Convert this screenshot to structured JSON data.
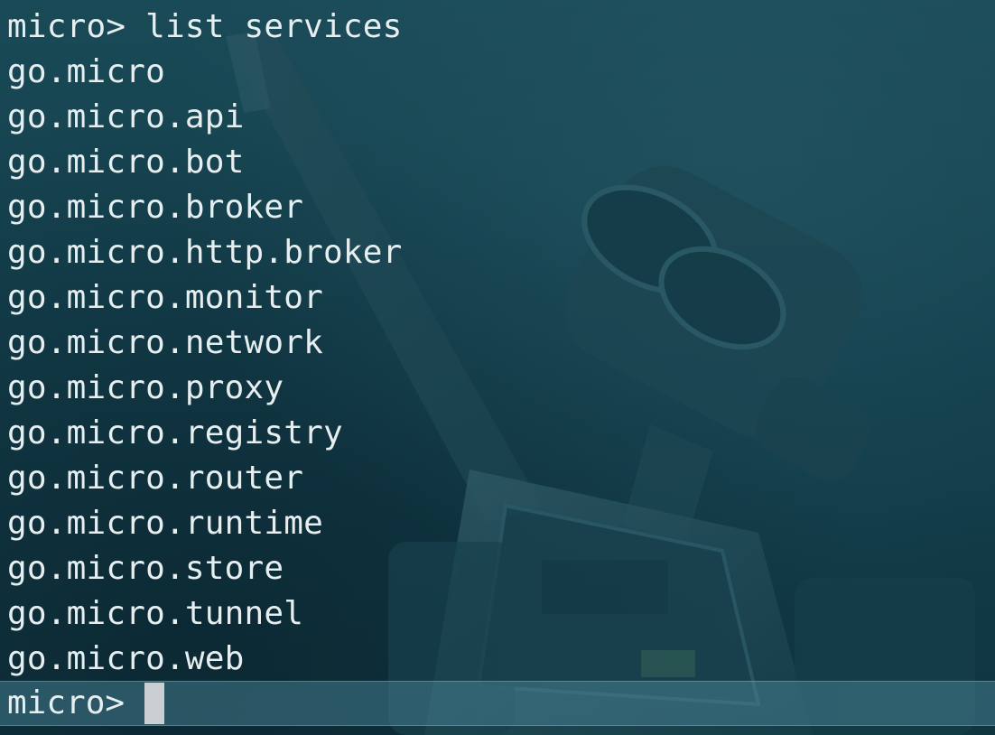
{
  "terminal": {
    "command_line": "micro> list services",
    "output": [
      "go.micro",
      "go.micro.api",
      "go.micro.bot",
      "go.micro.broker",
      "go.micro.http.broker",
      "go.micro.monitor",
      "go.micro.network",
      "go.micro.proxy",
      "go.micro.registry",
      "go.micro.router",
      "go.micro.runtime",
      "go.micro.store",
      "go.micro.tunnel",
      "go.micro.web"
    ],
    "prompt": "micro> ",
    "input_value": ""
  },
  "colors": {
    "background": "#133f4c",
    "text": "#e6eef0",
    "cursor": "#c9cfd2",
    "prompt_highlight": "#4f8ca0"
  }
}
